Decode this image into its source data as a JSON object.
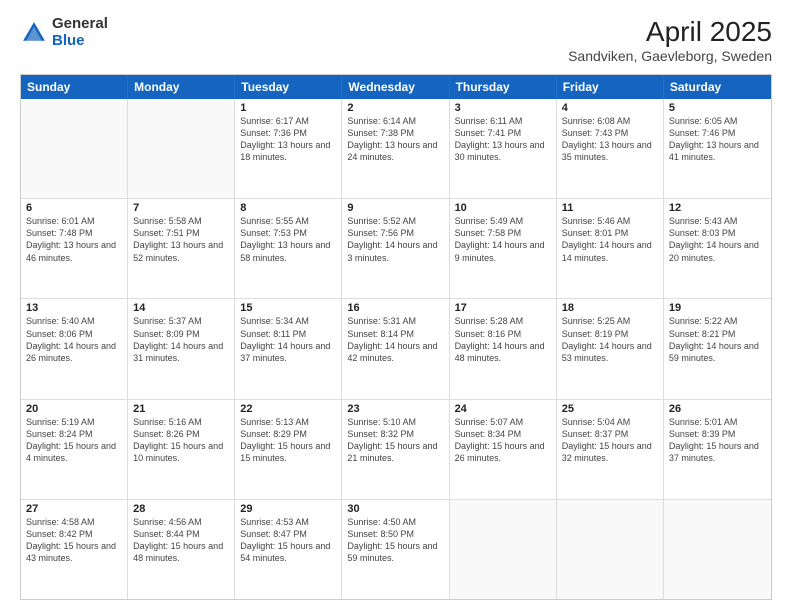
{
  "logo": {
    "general": "General",
    "blue": "Blue"
  },
  "title": "April 2025",
  "subtitle": "Sandviken, Gaevleborg, Sweden",
  "days_of_week": [
    "Sunday",
    "Monday",
    "Tuesday",
    "Wednesday",
    "Thursday",
    "Friday",
    "Saturday"
  ],
  "weeks": [
    [
      {
        "day": "",
        "info": ""
      },
      {
        "day": "",
        "info": ""
      },
      {
        "day": "1",
        "info": "Sunrise: 6:17 AM\nSunset: 7:36 PM\nDaylight: 13 hours\nand 18 minutes."
      },
      {
        "day": "2",
        "info": "Sunrise: 6:14 AM\nSunset: 7:38 PM\nDaylight: 13 hours\nand 24 minutes."
      },
      {
        "day": "3",
        "info": "Sunrise: 6:11 AM\nSunset: 7:41 PM\nDaylight: 13 hours\nand 30 minutes."
      },
      {
        "day": "4",
        "info": "Sunrise: 6:08 AM\nSunset: 7:43 PM\nDaylight: 13 hours\nand 35 minutes."
      },
      {
        "day": "5",
        "info": "Sunrise: 6:05 AM\nSunset: 7:46 PM\nDaylight: 13 hours\nand 41 minutes."
      }
    ],
    [
      {
        "day": "6",
        "info": "Sunrise: 6:01 AM\nSunset: 7:48 PM\nDaylight: 13 hours\nand 46 minutes."
      },
      {
        "day": "7",
        "info": "Sunrise: 5:58 AM\nSunset: 7:51 PM\nDaylight: 13 hours\nand 52 minutes."
      },
      {
        "day": "8",
        "info": "Sunrise: 5:55 AM\nSunset: 7:53 PM\nDaylight: 13 hours\nand 58 minutes."
      },
      {
        "day": "9",
        "info": "Sunrise: 5:52 AM\nSunset: 7:56 PM\nDaylight: 14 hours\nand 3 minutes."
      },
      {
        "day": "10",
        "info": "Sunrise: 5:49 AM\nSunset: 7:58 PM\nDaylight: 14 hours\nand 9 minutes."
      },
      {
        "day": "11",
        "info": "Sunrise: 5:46 AM\nSunset: 8:01 PM\nDaylight: 14 hours\nand 14 minutes."
      },
      {
        "day": "12",
        "info": "Sunrise: 5:43 AM\nSunset: 8:03 PM\nDaylight: 14 hours\nand 20 minutes."
      }
    ],
    [
      {
        "day": "13",
        "info": "Sunrise: 5:40 AM\nSunset: 8:06 PM\nDaylight: 14 hours\nand 26 minutes."
      },
      {
        "day": "14",
        "info": "Sunrise: 5:37 AM\nSunset: 8:09 PM\nDaylight: 14 hours\nand 31 minutes."
      },
      {
        "day": "15",
        "info": "Sunrise: 5:34 AM\nSunset: 8:11 PM\nDaylight: 14 hours\nand 37 minutes."
      },
      {
        "day": "16",
        "info": "Sunrise: 5:31 AM\nSunset: 8:14 PM\nDaylight: 14 hours\nand 42 minutes."
      },
      {
        "day": "17",
        "info": "Sunrise: 5:28 AM\nSunset: 8:16 PM\nDaylight: 14 hours\nand 48 minutes."
      },
      {
        "day": "18",
        "info": "Sunrise: 5:25 AM\nSunset: 8:19 PM\nDaylight: 14 hours\nand 53 minutes."
      },
      {
        "day": "19",
        "info": "Sunrise: 5:22 AM\nSunset: 8:21 PM\nDaylight: 14 hours\nand 59 minutes."
      }
    ],
    [
      {
        "day": "20",
        "info": "Sunrise: 5:19 AM\nSunset: 8:24 PM\nDaylight: 15 hours\nand 4 minutes."
      },
      {
        "day": "21",
        "info": "Sunrise: 5:16 AM\nSunset: 8:26 PM\nDaylight: 15 hours\nand 10 minutes."
      },
      {
        "day": "22",
        "info": "Sunrise: 5:13 AM\nSunset: 8:29 PM\nDaylight: 15 hours\nand 15 minutes."
      },
      {
        "day": "23",
        "info": "Sunrise: 5:10 AM\nSunset: 8:32 PM\nDaylight: 15 hours\nand 21 minutes."
      },
      {
        "day": "24",
        "info": "Sunrise: 5:07 AM\nSunset: 8:34 PM\nDaylight: 15 hours\nand 26 minutes."
      },
      {
        "day": "25",
        "info": "Sunrise: 5:04 AM\nSunset: 8:37 PM\nDaylight: 15 hours\nand 32 minutes."
      },
      {
        "day": "26",
        "info": "Sunrise: 5:01 AM\nSunset: 8:39 PM\nDaylight: 15 hours\nand 37 minutes."
      }
    ],
    [
      {
        "day": "27",
        "info": "Sunrise: 4:58 AM\nSunset: 8:42 PM\nDaylight: 15 hours\nand 43 minutes."
      },
      {
        "day": "28",
        "info": "Sunrise: 4:56 AM\nSunset: 8:44 PM\nDaylight: 15 hours\nand 48 minutes."
      },
      {
        "day": "29",
        "info": "Sunrise: 4:53 AM\nSunset: 8:47 PM\nDaylight: 15 hours\nand 54 minutes."
      },
      {
        "day": "30",
        "info": "Sunrise: 4:50 AM\nSunset: 8:50 PM\nDaylight: 15 hours\nand 59 minutes."
      },
      {
        "day": "",
        "info": ""
      },
      {
        "day": "",
        "info": ""
      },
      {
        "day": "",
        "info": ""
      }
    ]
  ]
}
